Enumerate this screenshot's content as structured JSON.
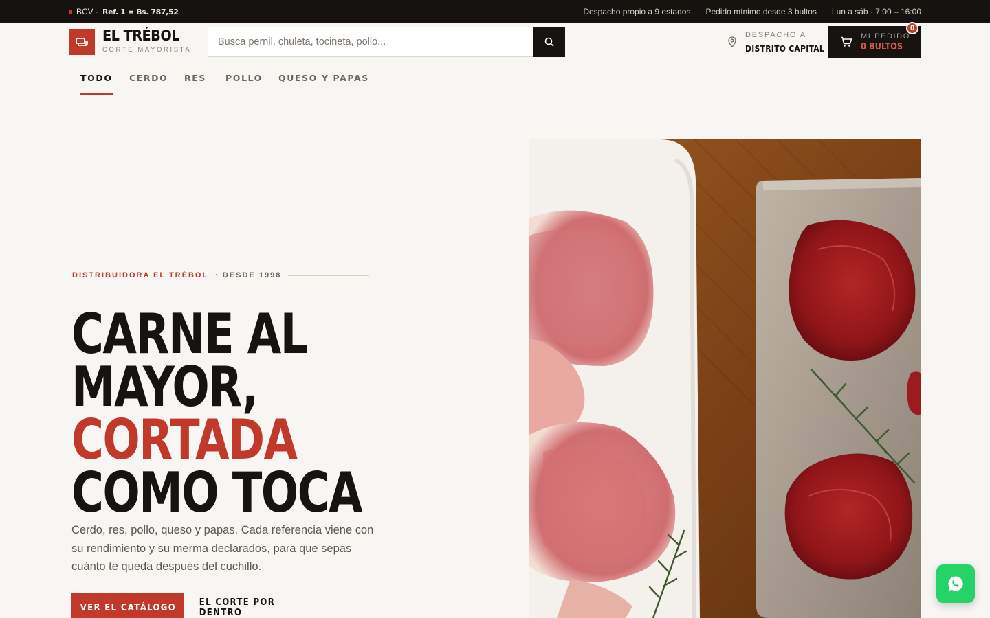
{
  "topbar": {
    "rate_label": "BCV ·",
    "rate_value": "Ref. 1 = Bs. 787,52",
    "info": [
      "Despacho propio a 9 estados",
      "Pedido mínimo desde 3 bultos",
      "Lun a sáb · 7:00 – 16:00"
    ]
  },
  "header": {
    "brand_name": "EL TRÉBOL",
    "brand_tagline": "CORTE MAYORISTA",
    "search_placeholder": "Busca pernil, chuleta, tocineta, pollo...",
    "shipping_label": "DESPACHO A",
    "shipping_value": "DISTRITO CAPITAL",
    "cart_label": "MI PEDIDO",
    "cart_value": "0 BULTOS",
    "cart_count": "0"
  },
  "nav": {
    "tabs": [
      {
        "label": "TODO",
        "active": true
      },
      {
        "label": "CERDO",
        "active": false
      },
      {
        "label": "RES",
        "active": false
      },
      {
        "label": "POLLO",
        "active": false
      },
      {
        "label": "QUESO Y PAPAS",
        "active": false
      }
    ]
  },
  "hero": {
    "eyebrow_brand": "DISTRIBUIDORA EL TRÉBOL",
    "eyebrow_since": "· DESDE 1998",
    "headline": [
      "CARNE AL",
      "MAYOR,",
      "CORTADA",
      "COMO TOCA"
    ],
    "lede": "Cerdo, res, pollo, queso y papas. Cada referencia viene con su rendimiento y su merma declarados, para que sepas cuánto te queda después del cuchillo.",
    "cta_primary": "VER EL CATÁLOGO",
    "cta_secondary": "EL CORTE POR DENTRO"
  },
  "colors": {
    "accent": "#c0392b",
    "ink": "#161311",
    "background": "#f8f6f2",
    "whatsapp": "#25d366"
  },
  "icons": {
    "logo": "cleaver-icon",
    "search": "search-icon",
    "location": "map-pin-icon",
    "cart": "cart-icon",
    "chat": "whatsapp-icon"
  }
}
